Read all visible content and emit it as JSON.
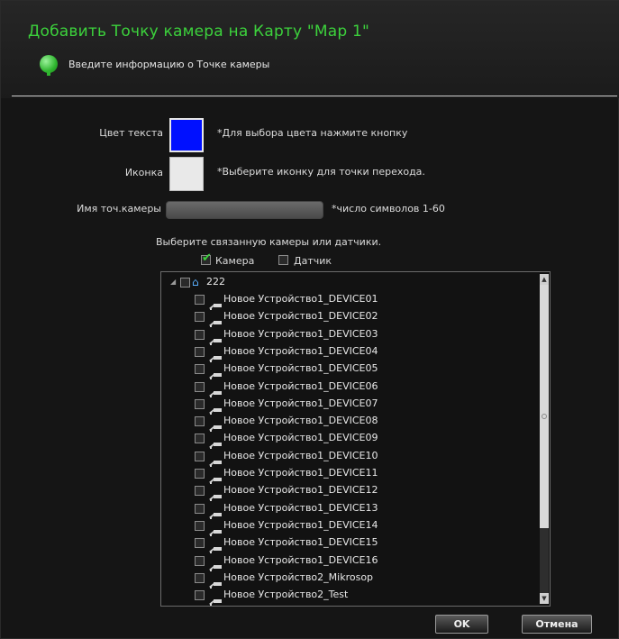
{
  "dialog": {
    "title": "Добавить Точку камера на Карту \"Map 1\"",
    "info_text": "Введите информацию о Точке камеры"
  },
  "form": {
    "text_color_label": "Цвет текста",
    "text_color_hint": "*Для выбора цвета нажмите кнопку",
    "text_color_value": "#0010ff",
    "icon_label": "Иконка",
    "icon_hint": "*Выберите иконку для точки перехода.",
    "name_label": "Имя точ.камеры",
    "name_value": "",
    "name_hint": "*число символов 1-60",
    "select_prompt": "Выберите связанную камеры или датчики.",
    "camera_filter": {
      "label": "Камера",
      "checked": true
    },
    "sensor_filter": {
      "label": "Датчик",
      "checked": false
    }
  },
  "tree": {
    "root": {
      "label": "222",
      "checked": false,
      "expanded": true
    },
    "items": [
      {
        "label": "Новое Устройство1_DEVICE01",
        "checked": false
      },
      {
        "label": "Новое Устройство1_DEVICE02",
        "checked": false
      },
      {
        "label": "Новое Устройство1_DEVICE03",
        "checked": false
      },
      {
        "label": "Новое Устройство1_DEVICE04",
        "checked": false
      },
      {
        "label": "Новое Устройство1_DEVICE05",
        "checked": false
      },
      {
        "label": "Новое Устройство1_DEVICE06",
        "checked": false
      },
      {
        "label": "Новое Устройство1_DEVICE07",
        "checked": false
      },
      {
        "label": "Новое Устройство1_DEVICE08",
        "checked": false
      },
      {
        "label": "Новое Устройство1_DEVICE09",
        "checked": false
      },
      {
        "label": "Новое Устройство1_DEVICE10",
        "checked": false
      },
      {
        "label": "Новое Устройство1_DEVICE11",
        "checked": false
      },
      {
        "label": "Новое Устройство1_DEVICE12",
        "checked": false
      },
      {
        "label": "Новое Устройство1_DEVICE13",
        "checked": false
      },
      {
        "label": "Новое Устройство1_DEVICE14",
        "checked": false
      },
      {
        "label": "Новое Устройство1_DEVICE15",
        "checked": false
      },
      {
        "label": "Новое Устройство1_DEVICE16",
        "checked": false
      },
      {
        "label": "Новое Устройство2_Mikrosop",
        "checked": false
      },
      {
        "label": "Новое Устройство2_Test",
        "checked": false
      }
    ]
  },
  "buttons": {
    "ok": "OK",
    "cancel": "Отмена"
  },
  "colors": {
    "title_green": "#3cd23c",
    "background": "#151515"
  }
}
